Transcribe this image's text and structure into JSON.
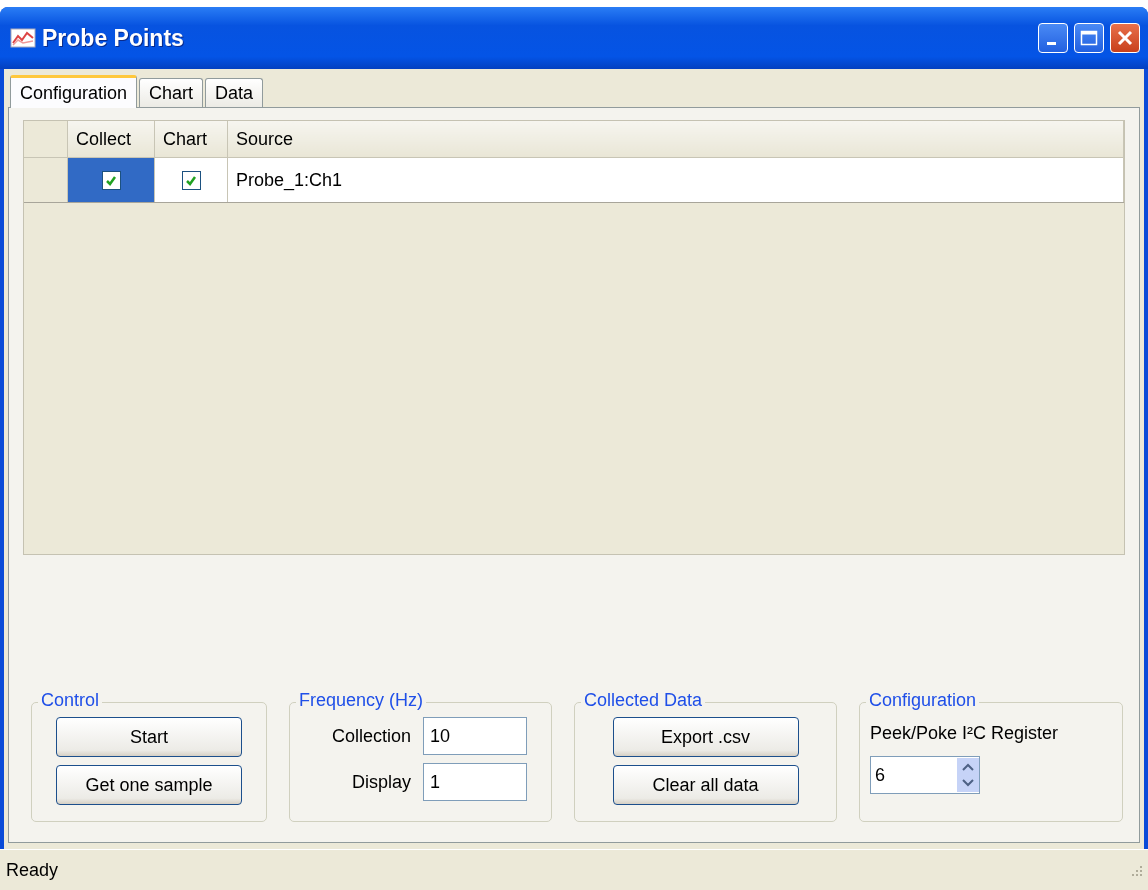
{
  "window": {
    "title": "Probe Points"
  },
  "tabs": [
    {
      "label": "Configuration",
      "selected": true
    },
    {
      "label": "Chart",
      "selected": false
    },
    {
      "label": "Data",
      "selected": false
    }
  ],
  "grid": {
    "columns": [
      "Collect",
      "Chart",
      "Source"
    ],
    "rows": [
      {
        "collect": true,
        "chart": true,
        "source": "Probe_1:Ch1",
        "selected": true
      }
    ]
  },
  "groups": [
    {
      "kind": "buttons",
      "title": "Control",
      "buttons": [
        "Start",
        "Get one sample"
      ]
    },
    {
      "kind": "fields",
      "title": "Frequency (Hz)",
      "fields": [
        {
          "label": "Collection",
          "value": "10"
        },
        {
          "label": "Display",
          "value": "1"
        }
      ]
    },
    {
      "kind": "buttons",
      "title": "Collected Data",
      "buttons": [
        "Export .csv",
        "Clear all data"
      ]
    },
    {
      "kind": "spinner",
      "title": "Configuration",
      "label": "Peek/Poke I²C Register",
      "value": "6"
    }
  ],
  "status_bar": "Ready"
}
